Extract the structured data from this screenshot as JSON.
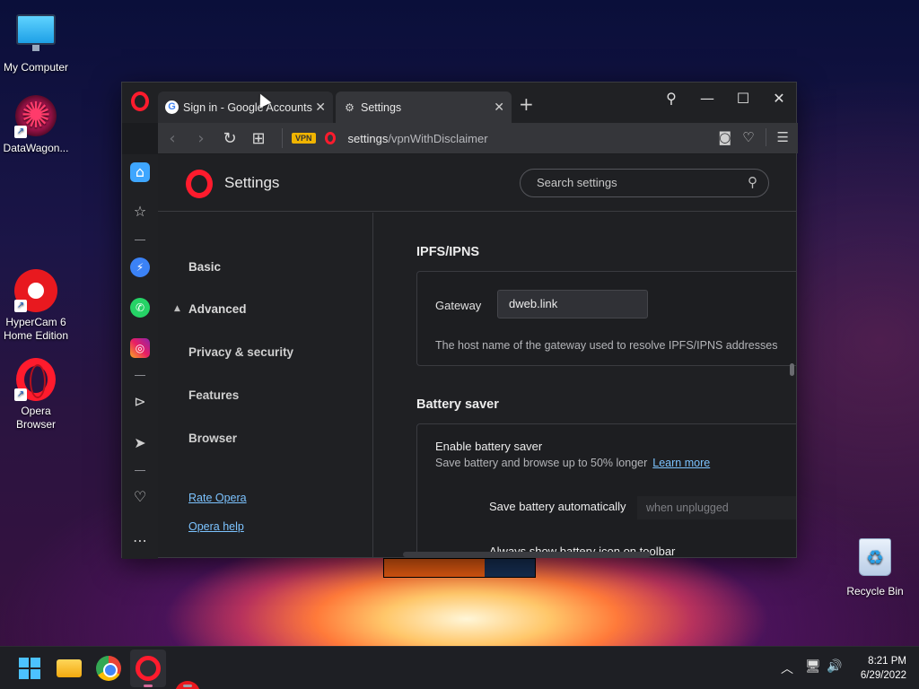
{
  "desktop": {
    "icons": [
      {
        "label": "My Computer"
      },
      {
        "label": "DataWagon..."
      },
      {
        "label": "HyperCam 6 Home Edition"
      },
      {
        "label": "Opera Browser"
      },
      {
        "label": "Recycle Bin"
      }
    ]
  },
  "browser": {
    "tabs": [
      {
        "label": "Sign in - Google Accounts",
        "icon": "google-icon"
      },
      {
        "label": "Settings",
        "icon": "gear-icon"
      }
    ],
    "address": {
      "vpn_badge": "VPN",
      "url_host": "settings",
      "url_path": "/vpnWithDisclaimer"
    }
  },
  "settings": {
    "title": "Settings",
    "search_placeholder": "Search settings",
    "nav": {
      "basic": "Basic",
      "advanced": "Advanced",
      "privacy": "Privacy & security",
      "features": "Features",
      "browser": "Browser",
      "rate": "Rate Opera",
      "help": "Opera help"
    },
    "ipfs": {
      "title": "IPFS/IPNS",
      "gateway_label": "Gateway",
      "gateway_value": "dweb.link",
      "gateway_desc": "The host name of the gateway used to resolve IPFS/IPNS addresses"
    },
    "battery": {
      "title": "Battery saver",
      "enable_label": "Enable battery saver",
      "enable_desc": "Save battery and browse up to 50% longer",
      "learn_more": "Learn more",
      "auto_label": "Save battery automatically",
      "auto_value": "when unplugged",
      "icon_label": "Always show battery icon on toolbar"
    }
  },
  "taskbar": {
    "time": "8:21 PM",
    "date": "6/29/2022"
  },
  "colors": {
    "accent": "#ff1b2d",
    "link": "#7cc3ff",
    "window_bg": "#1f2023"
  }
}
